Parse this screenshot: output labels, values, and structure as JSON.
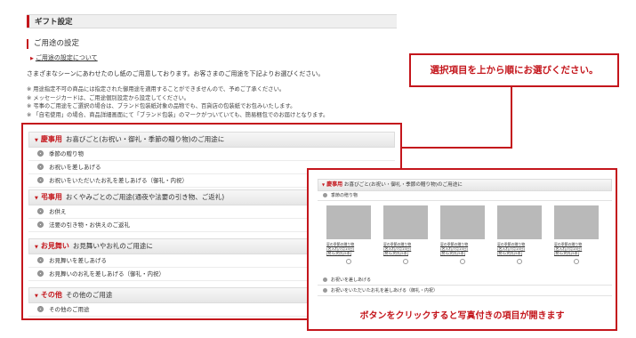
{
  "header": {
    "title": "ギフト設定"
  },
  "section": {
    "title": "ご用途の設定",
    "about_link": "ご用途の設定について",
    "intro": "さまざまなシーンにあわせたのし紙のご用意しております。お客さまのご用途を下記よりお選びください。",
    "notes": [
      "※ 用途指定不可の商品には指定された御用途を適用することができませんので、予めご了承ください。",
      "※ メッセージカードは、ご用途個別設定から設定してください。",
      "※ 弔事のご用途をご選択の場合は、ブランド包装紙対象の品物でも、百貨店の包装紙でお包みいたします。",
      "※ 「自宅使用」の場合、商品詳細画面にて「ブランド包装」のマークがついていても、簡易梱包でのお届けとなります。"
    ]
  },
  "categories": [
    {
      "name": "慶事用",
      "desc": "お喜びごと(お祝い・御礼・季節の贈り物)のご用途に",
      "options": [
        "季節の贈り物",
        "お祝いを差しあげる",
        "お祝いをいただいたお礼を差しあげる（御礼・内祝）"
      ]
    },
    {
      "name": "弔事用",
      "desc": "おくやみごとのご用途(通夜や法要の引き物、ご返礼)",
      "options": [
        "お供え",
        "法要の引き物・お供えのご返礼"
      ]
    },
    {
      "name": "お見舞い",
      "desc": "お見舞いやお礼のご用途に",
      "options": [
        "お見舞いを差しあげる",
        "お見舞いのお礼を差しあげる（御礼・内祝）"
      ]
    },
    {
      "name": "その他",
      "desc": "その他のご用途",
      "options": [
        "その他のご用途"
      ]
    }
  ],
  "callouts": {
    "top": "選択項目を上から順にお選びください。",
    "bottom": "ボタンをクリックすると写真付きの項目が開きます"
  },
  "detail": {
    "head_name": "慶事用",
    "head_desc": "お喜びごと(お祝い・御礼・季節の贈り物)のご用途に",
    "sub": "季節の贈り物",
    "products": [
      {
        "l1": "夏の季節の贈り物",
        "l2": "(名入れ/7月15日)",
        "l3": "[熨斗(的光)5本]"
      },
      {
        "l1": "夏の季節の贈り物",
        "l2": "(名入れ/7月15日)",
        "l3": "[熨斗(的光)5本]"
      },
      {
        "l1": "夏の季節の贈り物",
        "l2": "(名入れ/7月15日)",
        "l3": "[熨斗(的光)5本]"
      },
      {
        "l1": "夏の季節の贈り物",
        "l2": "(名入れ/7月15日)",
        "l3": "[熨斗(的光)5本]"
      },
      {
        "l1": "夏の季節の贈り物",
        "l2": "(名入れ/7月15日)",
        "l3": "[熨斗(的光)5本]"
      }
    ],
    "options": [
      "お祝いを差しあげる",
      "お祝いをいただいたお礼を差しあげる（御礼・内祝）"
    ]
  },
  "colors": {
    "accent": "#c4161c",
    "photo_placeholder": "#b9b9b9"
  }
}
